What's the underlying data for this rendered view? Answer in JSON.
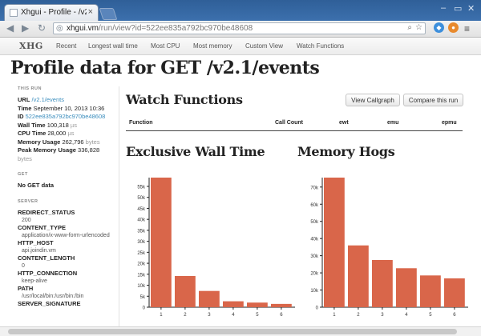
{
  "browser": {
    "tab_title": "Xhgui - Profile - /v2.1/ev",
    "url_host": "xhgui.vm",
    "url_path": "/run/view?id=522ee835a792bc970be48608"
  },
  "nav": {
    "brand": "XHG",
    "links": [
      "Recent",
      "Longest wall time",
      "Most CPU",
      "Most memory",
      "Custom View",
      "Watch Functions"
    ]
  },
  "page": {
    "title": "Profile data for GET /v2.1/events"
  },
  "this_run": {
    "heading": "THIS RUN",
    "url_label": "URL",
    "url_value": "/v2.1/events",
    "time_label": "Time",
    "time_value": "September 10, 2013 10:36",
    "id_label": "ID",
    "id_value": "522ee835a792bc970be48608",
    "wall_label": "Wall Time",
    "wall_value": "100,318",
    "wall_unit": "µs",
    "cpu_label": "CPU Time",
    "cpu_value": "28,000",
    "cpu_unit": "µs",
    "mem_label": "Memory Usage",
    "mem_value": "262,796",
    "mem_unit": "bytes",
    "peak_label": "Peak Memory Usage",
    "peak_value": "336,828",
    "peak_unit": "bytes"
  },
  "get": {
    "heading": "GET",
    "text": "No GET data"
  },
  "server": {
    "heading": "SERVER",
    "items": [
      {
        "key": "REDIRECT_STATUS",
        "value": "200"
      },
      {
        "key": "CONTENT_TYPE",
        "value": "application/x-www-form-urlencoded"
      },
      {
        "key": "HTTP_HOST",
        "value": "api.joindin.vm"
      },
      {
        "key": "CONTENT_LENGTH",
        "value": "0"
      },
      {
        "key": "HTTP_CONNECTION",
        "value": "keep-alive"
      },
      {
        "key": "PATH",
        "value": "/usr/local/bin:/usr/bin:/bin"
      },
      {
        "key": "SERVER_SIGNATURE",
        "value": ""
      }
    ]
  },
  "watch": {
    "title": "Watch Functions",
    "callgraph_button": "View Callgraph",
    "compare_button": "Compare this run",
    "columns": [
      "Function",
      "Call Count",
      "ewt",
      "emu",
      "epmu"
    ]
  },
  "colors": {
    "bar": "#d9664a",
    "link": "#3a8dbd"
  },
  "chart_data": [
    {
      "type": "bar",
      "title": "Exclusive Wall Time",
      "categories": [
        "1",
        "2",
        "3",
        "4",
        "5",
        "6"
      ],
      "values": [
        59000,
        14200,
        7400,
        2700,
        2100,
        1500
      ],
      "yticks": [
        0,
        5000,
        10000,
        15000,
        20000,
        25000,
        30000,
        35000,
        40000,
        45000,
        50000,
        55000
      ],
      "ytick_labels": [
        "0",
        "5k",
        "10k",
        "15k",
        "20k",
        "25k",
        "30k",
        "35k",
        "40k",
        "45k",
        "50k",
        "55k"
      ],
      "ylim": [
        0,
        59000
      ]
    },
    {
      "type": "bar",
      "title": "Memory Hogs",
      "categories": [
        "1",
        "2",
        "3",
        "4",
        "5",
        "6"
      ],
      "values": [
        75500,
        36000,
        27500,
        22700,
        18500,
        16800
      ],
      "yticks": [
        0,
        10000,
        20000,
        30000,
        40000,
        50000,
        60000,
        70000
      ],
      "ytick_labels": [
        "0",
        "10k",
        "20k",
        "30k",
        "40k",
        "50k",
        "60k",
        "70k"
      ],
      "ylim": [
        0,
        75500
      ]
    }
  ]
}
